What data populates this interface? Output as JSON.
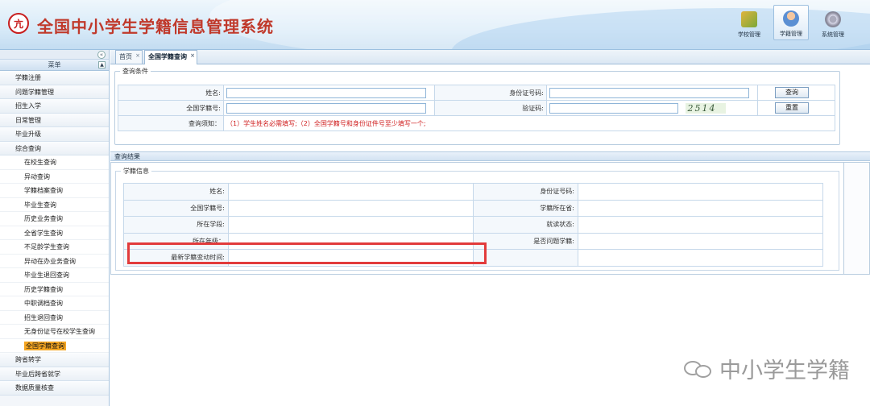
{
  "header": {
    "logo_glyph": "亢",
    "title": "全国中小学生学籍信息管理系统",
    "nav": [
      {
        "label": "学校管理",
        "icon": "school-icon"
      },
      {
        "label": "学籍管理",
        "icon": "user-icon",
        "active": true
      },
      {
        "label": "系统管理",
        "icon": "gear-icon"
      }
    ]
  },
  "sidebar": {
    "menu_title": "菜单",
    "items_top": [
      "学籍注册",
      "问题学籍管理",
      "招生入学",
      "日常管理",
      "毕业升级",
      "综合查询"
    ],
    "sub_items": [
      "在校生查询",
      "异动查询",
      "学籍档案查询",
      "毕业生查询",
      "历史业务查询",
      "全省学生查询",
      "不足龄学生查询",
      "异动在办业务查询",
      "毕业生退回查询",
      "历史学籍查询",
      "中职调档查询",
      "招生退回查询",
      "无身份证号在校学生查询",
      "全国学籍查询"
    ],
    "active_sub": "全国学籍查询",
    "items_bottom": [
      "跨省转学",
      "毕业后跨省就学",
      "数据质量核查"
    ]
  },
  "tabs": [
    {
      "label": "首页"
    },
    {
      "label": "全国学籍查询",
      "active": true
    }
  ],
  "query": {
    "legend": "查询条件",
    "name_label": "姓名:",
    "id_label": "身份证号码:",
    "student_no_label": "全国学籍号:",
    "captcha_label": "验证码:",
    "captcha_text": "2514",
    "notice_label": "查询须知：",
    "notice": "（1）学生姓名必需填写;（2）全国学籍号和身份证件号至少填写一个;",
    "search_button": "查询",
    "reset_button": "重置"
  },
  "results": {
    "bar_title": "查询结果",
    "legend": "学籍信息",
    "rows": [
      {
        "l1": "姓名:",
        "l2": "身份证号码:"
      },
      {
        "l1": "全国学籍号:",
        "l2": "学籍所在省:"
      },
      {
        "l1": "所在学段:",
        "l2": "就读状态:"
      },
      {
        "l1": "所在年级：",
        "l2": "是否问题学籍:"
      },
      {
        "l1": "最新学籍变动时间:",
        "l2": ""
      }
    ]
  },
  "watermark": "中小学生学籍",
  "colors": {
    "title_red": "#c0392b",
    "highlight": "#e23b3b",
    "active_menu": "#f5a623"
  }
}
